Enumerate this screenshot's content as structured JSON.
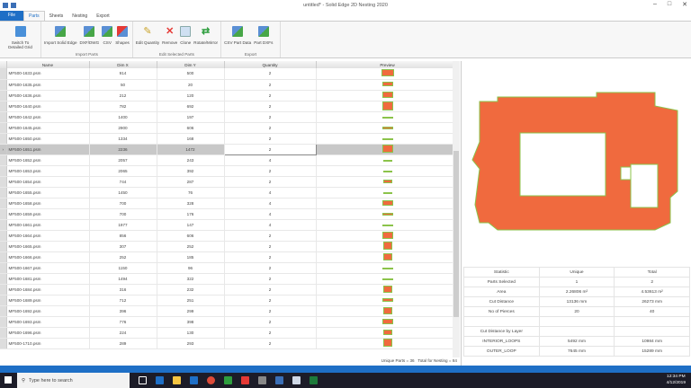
{
  "window": {
    "title": "untitled* - Solid Edge 2D Nesting 2020"
  },
  "tabs": [
    "File",
    "Parts",
    "Sheets",
    "Nesting",
    "Export"
  ],
  "ribbon": {
    "groups": [
      {
        "label": "",
        "buttons": [
          "Switch To Detailed Grid"
        ]
      },
      {
        "label": "Import Parts",
        "buttons": [
          "Import Solid Edge",
          "DXF/DWG",
          "CSV",
          "Shapes"
        ]
      },
      {
        "label": "Edit Selected Parts",
        "buttons": [
          "Edit Quantity",
          "Remove",
          "Clone",
          "Rotate/Mirror"
        ]
      },
      {
        "label": "Export",
        "buttons": [
          "CSV Part Data",
          "Part DXFs"
        ]
      }
    ]
  },
  "grid": {
    "columns": [
      "Name",
      "Dim X",
      "Dim Y",
      "Quantity",
      "Preview"
    ],
    "rows": [
      [
        "MF500-1633.psm",
        "914",
        "500",
        "2"
      ],
      [
        "MF500-1635.psm",
        "50",
        "20",
        "2"
      ],
      [
        "MF500-1636.psm",
        "212",
        "120",
        "2"
      ],
      [
        "MF500-1640.psm",
        "782",
        "692",
        "2"
      ],
      [
        "MF500-1642.psm",
        "1400",
        "197",
        "2"
      ],
      [
        "MF500-1645.psm",
        "2900",
        "606",
        "2"
      ],
      [
        "MF500-1650.psm",
        "1334",
        "168",
        "2"
      ],
      [
        "MF500-1651.psm",
        "2236",
        "1472",
        "2"
      ],
      [
        "MF500-1652.psm",
        "2057",
        "243",
        "4"
      ],
      [
        "MF500-1653.psm",
        "2065",
        "392",
        "2"
      ],
      [
        "MF500-1654.psm",
        "744",
        "287",
        "2"
      ],
      [
        "MF500-1655.psm",
        "1450",
        "76",
        "4"
      ],
      [
        "MF500-1658.psm",
        "700",
        "328",
        "4"
      ],
      [
        "MF500-1659.psm",
        "700",
        "176",
        "4"
      ],
      [
        "MF500-1661.psm",
        "1977",
        "147",
        "4"
      ],
      [
        "MF500-1664.psm",
        "856",
        "606",
        "2"
      ],
      [
        "MF500-1665.psm",
        "307",
        "252",
        "2"
      ],
      [
        "MF500-1666.psm",
        "252",
        "185",
        "2"
      ],
      [
        "MF500-1667.psm",
        "1150",
        "96",
        "2"
      ],
      [
        "MF500-1681.psm",
        "1494",
        "322",
        "2"
      ],
      [
        "MF500-1684.psm",
        "316",
        "232",
        "2"
      ],
      [
        "MF500-1689.psm",
        "712",
        "251",
        "2"
      ],
      [
        "MF500-1692.psm",
        "396",
        "299",
        "2"
      ],
      [
        "MF500-1693.psm",
        "776",
        "398",
        "2"
      ],
      [
        "MF500-1696.psm",
        "224",
        "130",
        "2"
      ],
      [
        "MF500-1710.psm",
        "289",
        "293",
        "2"
      ]
    ],
    "selected_index": 7,
    "footer": {
      "unique_label": "Unique Parts",
      "unique": "36",
      "total_label": "Total for Nesting",
      "total": "84"
    }
  },
  "stats": {
    "headers": [
      "Statistic",
      "Unique",
      "Total"
    ],
    "rows": [
      [
        "Parts Selected",
        "1",
        "2"
      ],
      [
        "Area",
        "2.26806 m²",
        "4.53613 m²"
      ],
      [
        "Cut Distance",
        "13136 mm",
        "26273 mm"
      ],
      [
        "No of Pierces",
        "20",
        "40"
      ],
      [
        "",
        "",
        ""
      ],
      [
        "Cut Distance by Layer",
        "",
        ""
      ],
      [
        "INTERIOR_LOOPS",
        "5492 mm",
        "10984 mm"
      ],
      [
        "OUTER_LOOP",
        "7645 mm",
        "15289 mm"
      ]
    ]
  },
  "taskbar": {
    "search_placeholder": "Type here to search",
    "time": "12:34 PM",
    "date": "4/12/2019"
  },
  "colors": {
    "accent": "#1e6fc6",
    "part_fill": "#f06a3e",
    "part_edge": "#8bc34a"
  }
}
